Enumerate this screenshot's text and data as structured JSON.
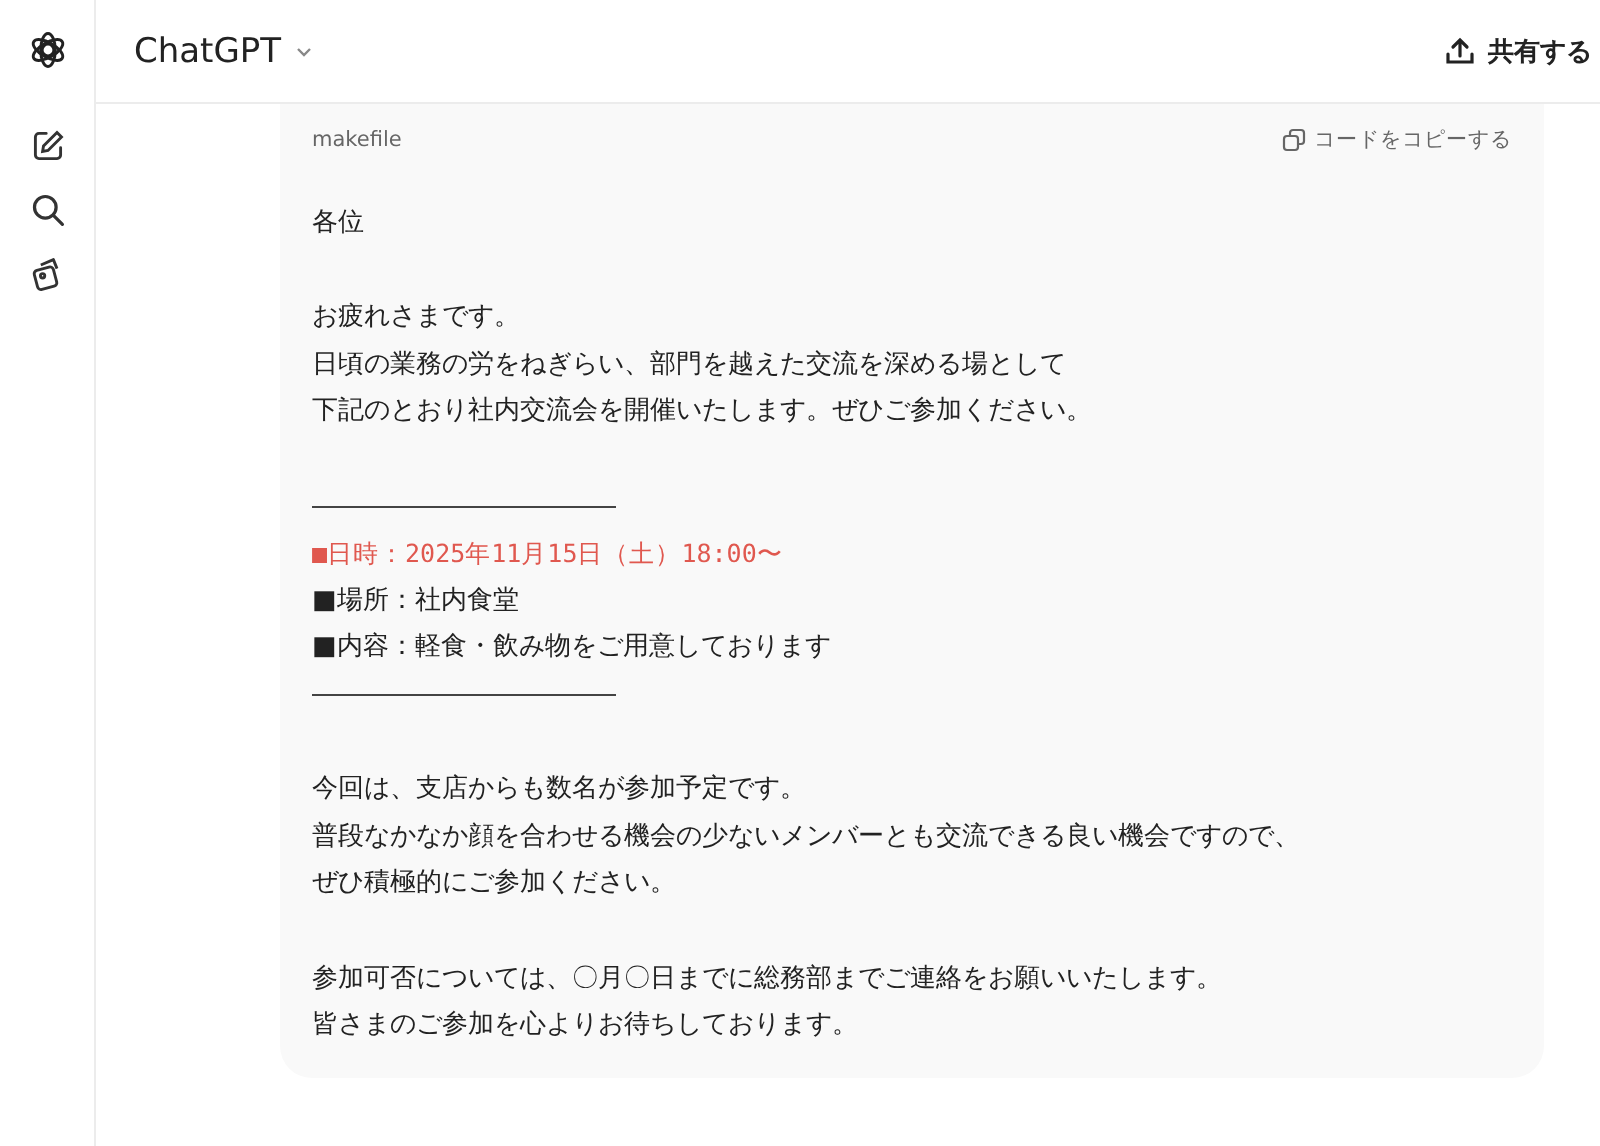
{
  "header": {
    "title": "ChatGPT",
    "share": "共有する"
  },
  "code_block": {
    "language": "makefile",
    "copy": "コードをコピーする",
    "lines": [
      {
        "kind": "text",
        "text": "各位"
      },
      {
        "kind": "blank"
      },
      {
        "kind": "text",
        "text": "お疲れさまです。"
      },
      {
        "kind": "text",
        "text": "日頃の業務の労をねぎらい、部門を越えた交流を深める場として"
      },
      {
        "kind": "text",
        "text": "下記のとおり社内交流会を開催いたします。ぜひご参加ください。"
      },
      {
        "kind": "blank"
      },
      {
        "kind": "rule"
      },
      {
        "kind": "highlight",
        "text": "■日時：2025年11月15日（土）18:00〜"
      },
      {
        "kind": "text",
        "text": "■場所：社内食堂"
      },
      {
        "kind": "text",
        "text": "■内容：軽食・飲み物をご用意しております"
      },
      {
        "kind": "rule"
      },
      {
        "kind": "blank"
      },
      {
        "kind": "text",
        "text": "今回は、支店からも数名が参加予定です。"
      },
      {
        "kind": "text",
        "text": "普段なかなか顔を合わせる機会の少ないメンバーとも交流できる良い機会ですので、"
      },
      {
        "kind": "text",
        "text": "ぜひ積極的にご参加ください。"
      },
      {
        "kind": "blank"
      },
      {
        "kind": "text",
        "text": "参加可否については、〇月〇日までに総務部までご連絡をお願いいたします。"
      },
      {
        "kind": "text",
        "text": "皆さまのご参加を心よりお待ちしております。"
      }
    ]
  }
}
